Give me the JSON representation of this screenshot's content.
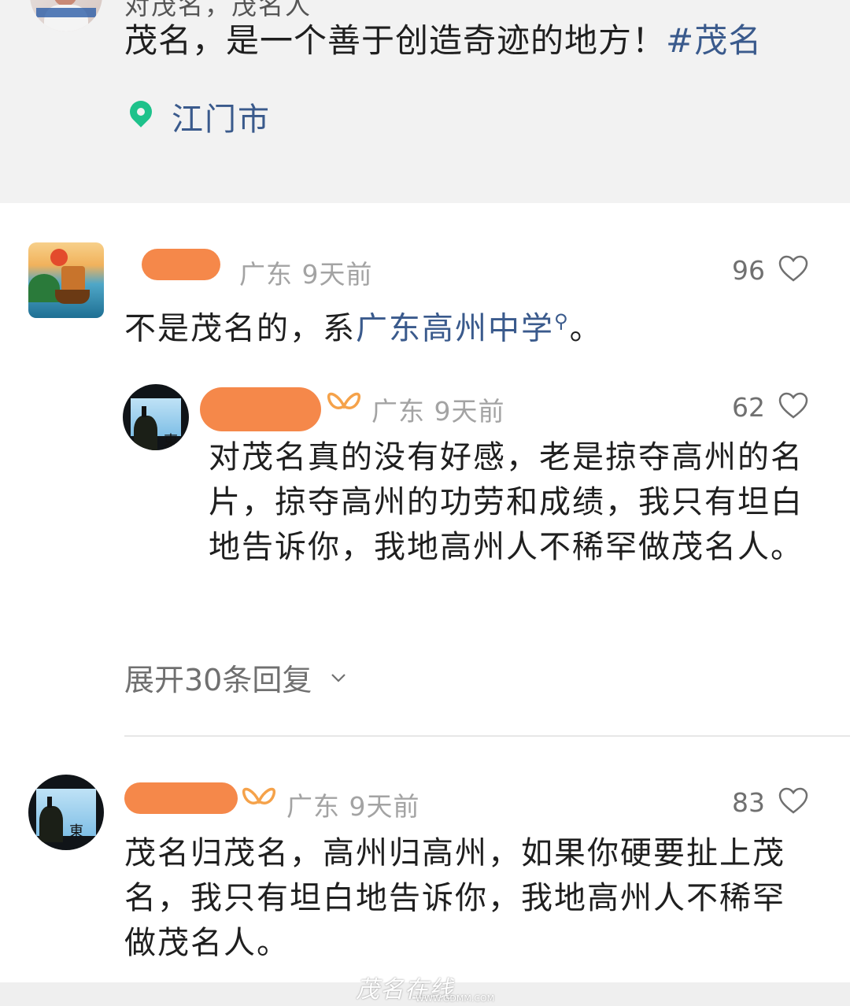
{
  "post": {
    "top_line_partial": "对茂名，茂名人",
    "text": "茂名，是一个善于创造奇迹的地方！",
    "hashtag": "#茂名",
    "location": "江门市"
  },
  "comments": [
    {
      "region": "广东",
      "time": "9天前",
      "likes": "96",
      "text_before": "不是茂名的，系",
      "link": "广东高州中学",
      "text_after": "。",
      "reply": {
        "region": "广东",
        "time": "9天前",
        "likes": "62",
        "text": "对茂名真的没有好感，老是掠夺高州的名片，掠夺高州的功劳和成绩，我只有坦白地告诉你，我地高州人不稀罕做茂名人。"
      },
      "expand_label": "展开30条回复"
    },
    {
      "region": "广东",
      "time": "9天前",
      "likes": "83",
      "text": "茂名归茂名，高州归高州，如果你硬要扯上茂名，我只有坦白地告诉你，我地高州人不稀罕做茂名人。"
    }
  ],
  "watermark": {
    "brand": "茂名在线",
    "url": "WWW.GDMM.COM"
  },
  "colors": {
    "link": "#3a5a8c",
    "location_pin": "#1ec28b",
    "redaction": "#f5884a",
    "meta": "#a3a3a3"
  }
}
